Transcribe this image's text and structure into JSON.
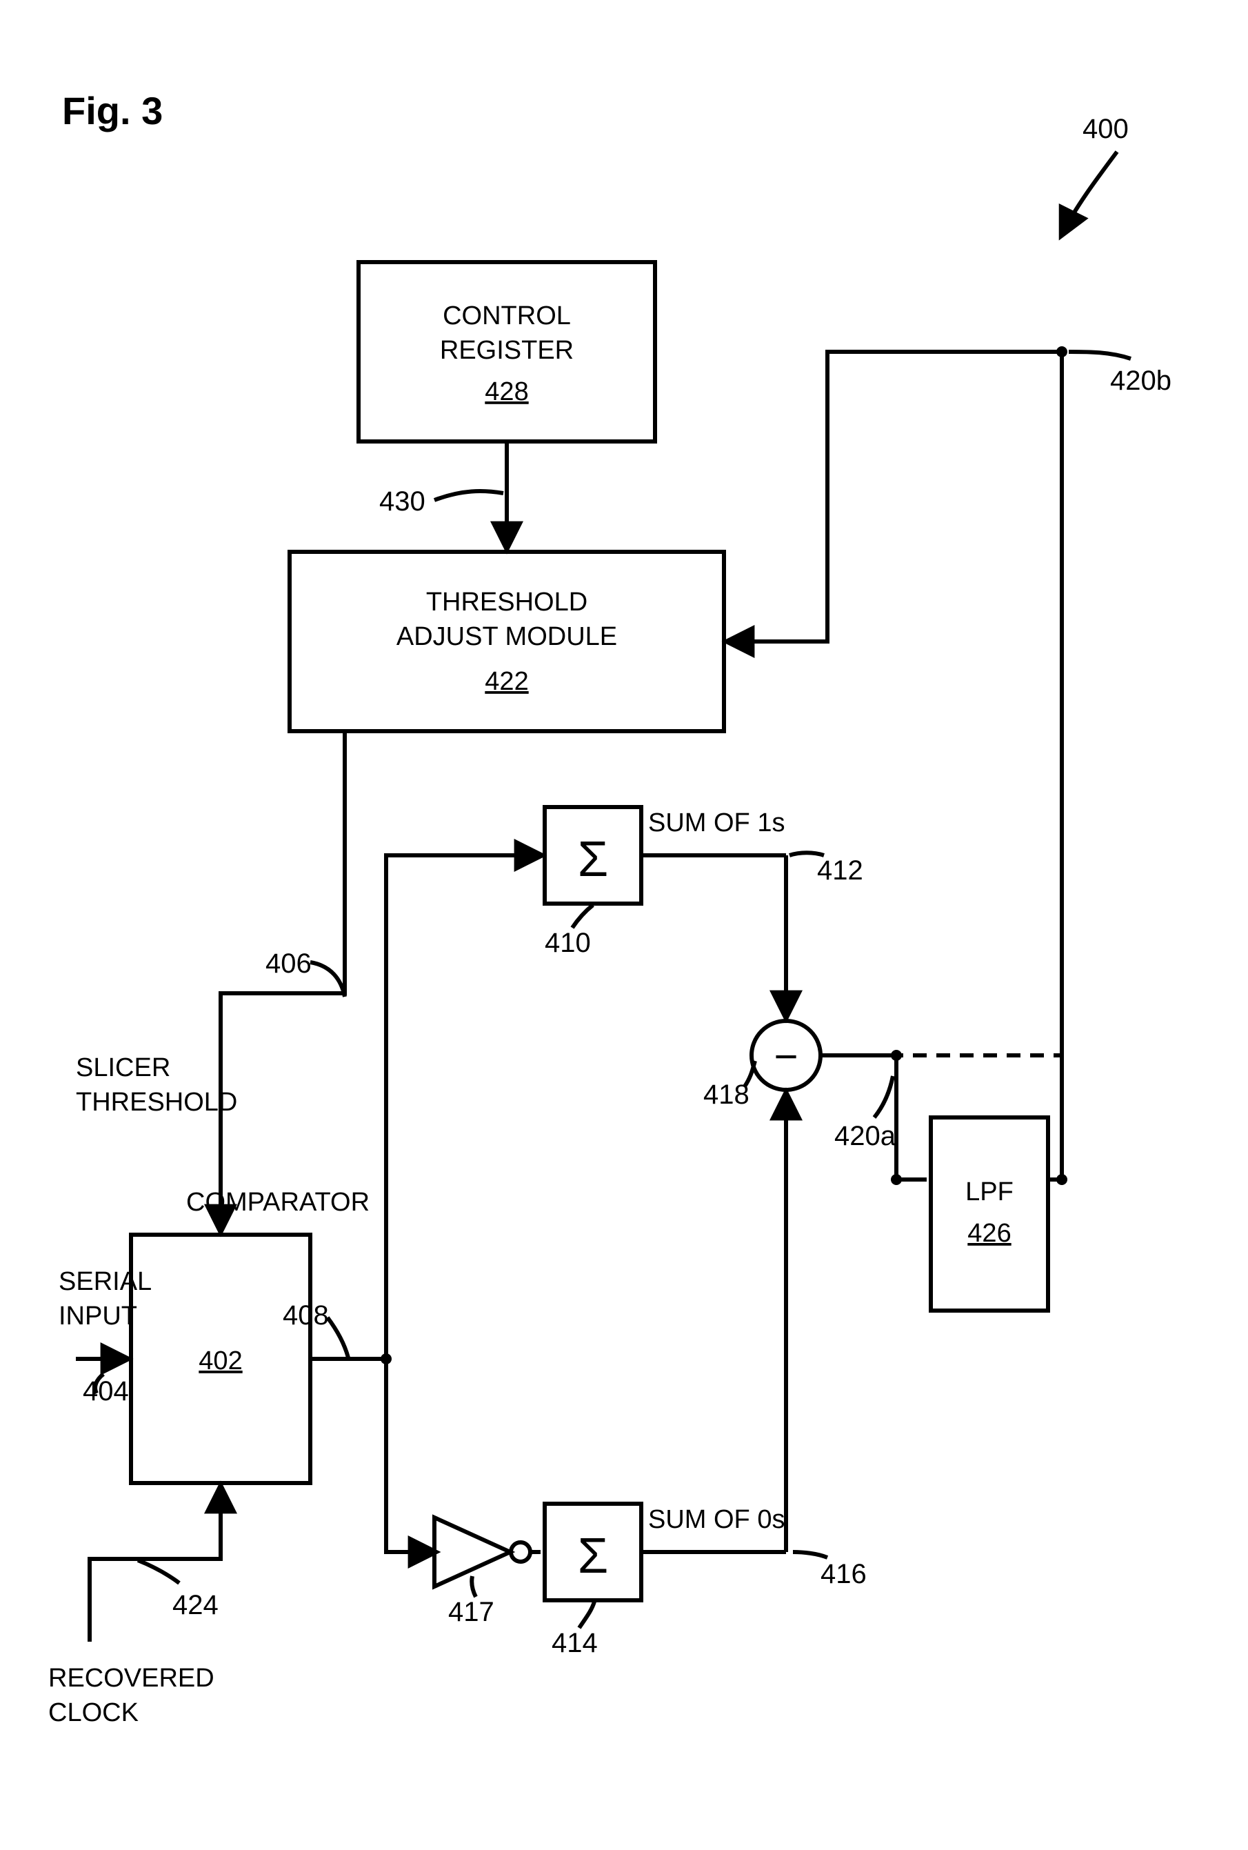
{
  "figure": {
    "title": "Fig. 3",
    "system_ref": "400"
  },
  "blocks": {
    "control_register": {
      "line1": "CONTROL",
      "line2": "REGISTER",
      "ref": "428"
    },
    "threshold_adjust": {
      "line1": "THRESHOLD",
      "line2": "ADJUST MODULE",
      "ref": "422"
    },
    "comparator_block": {
      "ref": "402"
    },
    "lpf": {
      "name": "LPF",
      "ref": "426"
    }
  },
  "sums": {
    "sigma": "Σ",
    "sum1_label": "SUM OF 1s",
    "sum0_label": "SUM OF 0s",
    "sum1_block_ref": "410",
    "sum0_block_ref": "414",
    "sum1_signal_ref": "412",
    "sum0_signal_ref": "416",
    "inverter_ref": "417",
    "subtractor": {
      "minus": "−",
      "ref": "418"
    }
  },
  "signals": {
    "slicer_threshold": {
      "line1": "SLICER",
      "line2": "THRESHOLD",
      "ref": "406"
    },
    "serial_input": {
      "line1": "SERIAL",
      "line2": "INPUT",
      "ref": "404"
    },
    "recovered_clock": {
      "line1": "RECOVERED",
      "line2": "CLOCK",
      "ref": "424"
    },
    "comparator_label": "COMPARATOR",
    "comparator_out_ref": "408",
    "error_a_ref": "420a",
    "error_b_ref": "420b",
    "register_link_ref": "430"
  }
}
